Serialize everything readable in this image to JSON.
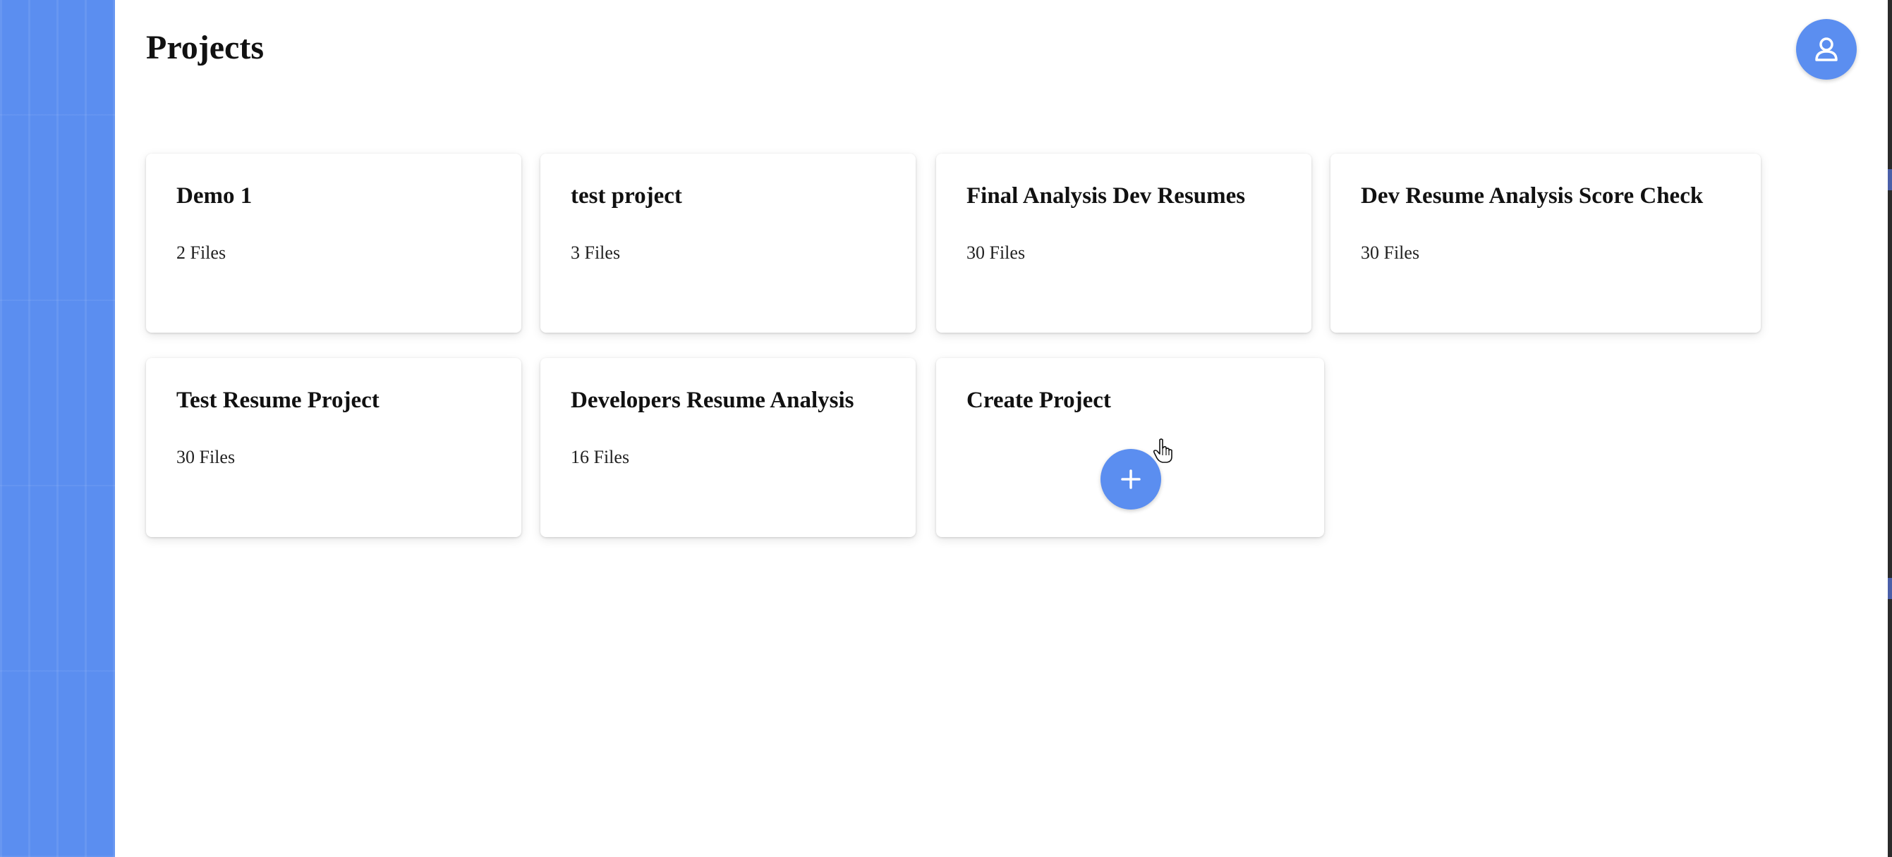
{
  "header": {
    "title": "Projects",
    "avatar_icon": "user-icon"
  },
  "projects": [
    {
      "name": "Demo 1",
      "files": "2 Files"
    },
    {
      "name": "test project",
      "files": "3 Files"
    },
    {
      "name": "Final Analysis Dev Resumes",
      "files": "30 Files"
    },
    {
      "name": "Dev Resume Analysis Score Check",
      "files": "30 Files"
    },
    {
      "name": "Test Resume Project",
      "files": "30 Files"
    },
    {
      "name": "Developers Resume Analysis",
      "files": "16 Files"
    }
  ],
  "create_card": {
    "label": "Create Project",
    "button_icon": "plus-icon"
  },
  "colors": {
    "accent": "#5b8ef0",
    "sidebar": "#5b8ef0",
    "background": "#ffffff"
  }
}
